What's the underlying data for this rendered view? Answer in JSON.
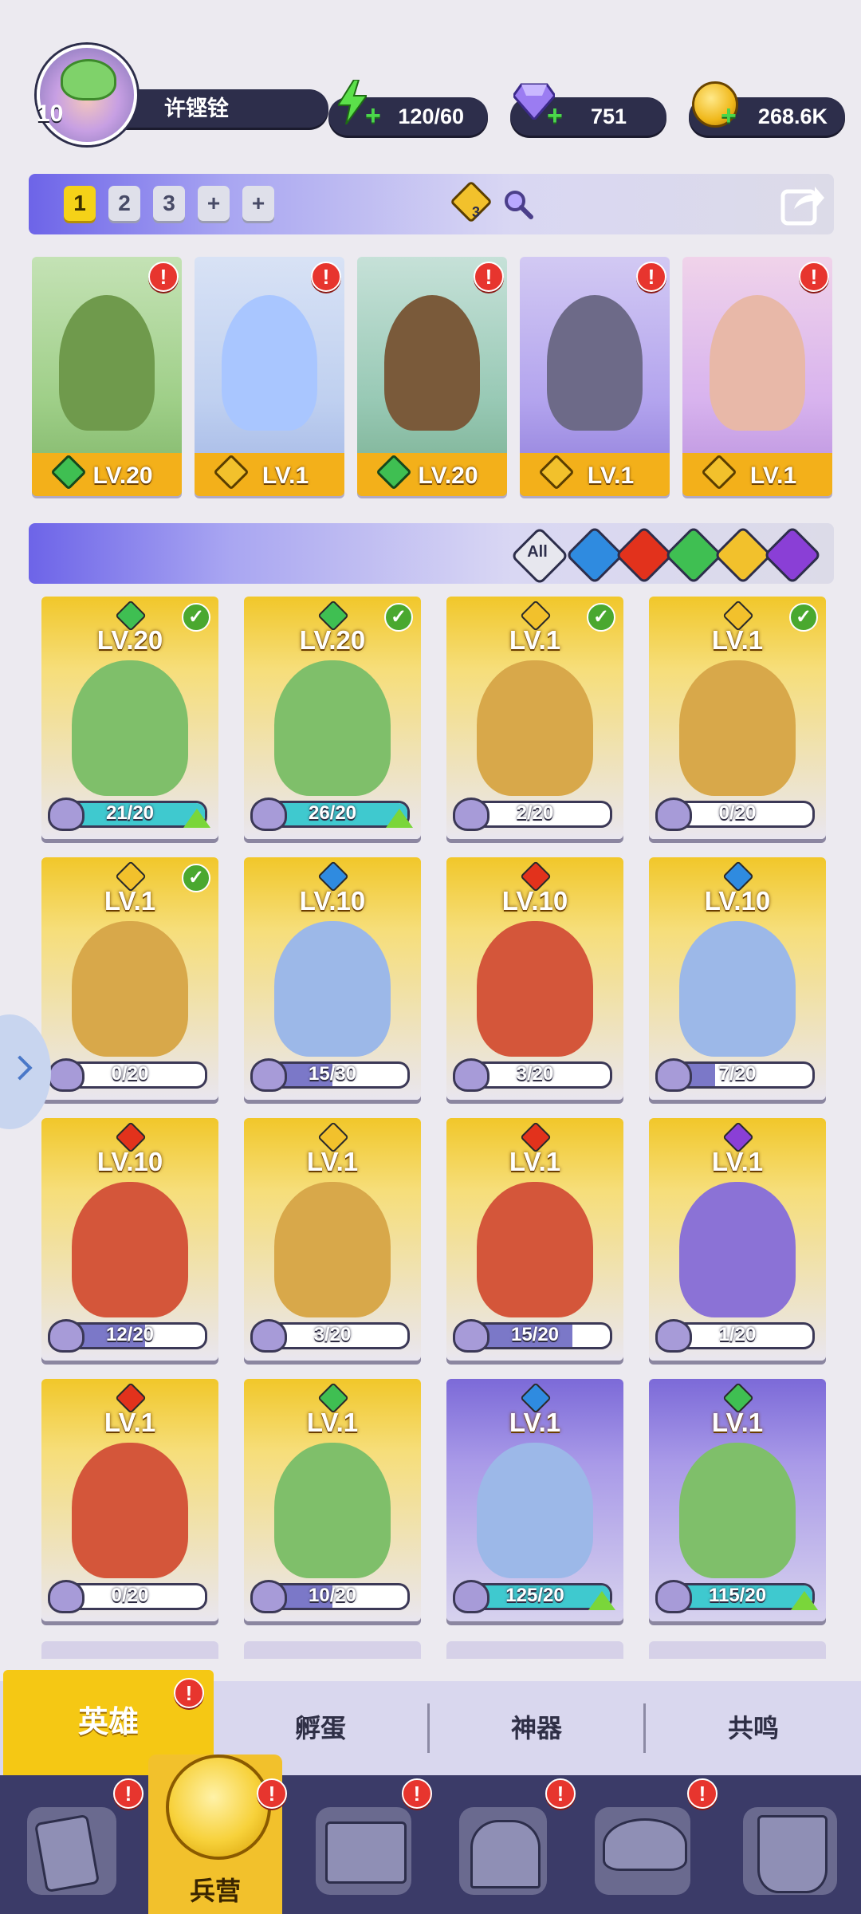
{
  "profile": {
    "level": "10",
    "name": "许铿铨"
  },
  "resources": {
    "energy": "120/60",
    "gems": "751",
    "gold": "268.6K"
  },
  "team_bar": {
    "slots": [
      "1",
      "2",
      "3",
      "+",
      "+"
    ],
    "active_slot": "1",
    "badge_count": "3"
  },
  "team": [
    {
      "level": "LV.20",
      "element": "green",
      "alert": "!"
    },
    {
      "level": "LV.1",
      "element": "gold",
      "alert": "!"
    },
    {
      "level": "LV.20",
      "element": "green",
      "alert": "!"
    },
    {
      "level": "LV.1",
      "element": "gold",
      "alert": "!"
    },
    {
      "level": "LV.1",
      "element": "gold",
      "alert": "!"
    }
  ],
  "filters": {
    "all": "All",
    "elements": [
      "water",
      "fire",
      "wind",
      "light",
      "dark"
    ]
  },
  "heroes": [
    {
      "level": "LV.20",
      "progress": "21/20",
      "element": "green",
      "checked": true,
      "upgrade": true,
      "fill": 1.0
    },
    {
      "level": "LV.20",
      "progress": "26/20",
      "element": "green",
      "checked": true,
      "upgrade": true,
      "fill": 1.0
    },
    {
      "level": "LV.1",
      "progress": "2/20",
      "element": "gold",
      "checked": true,
      "upgrade": false,
      "fill": 0.1
    },
    {
      "level": "LV.1",
      "progress": "0/20",
      "element": "gold",
      "checked": true,
      "upgrade": false,
      "fill": 0.0
    },
    {
      "level": "LV.1",
      "progress": "0/20",
      "element": "gold",
      "checked": true,
      "upgrade": false,
      "fill": 0.0
    },
    {
      "level": "LV.10",
      "progress": "15/30",
      "element": "blue",
      "checked": false,
      "upgrade": false,
      "fill": 0.5
    },
    {
      "level": "LV.10",
      "progress": "3/20",
      "element": "red",
      "checked": false,
      "upgrade": false,
      "fill": 0.15
    },
    {
      "level": "LV.10",
      "progress": "7/20",
      "element": "blue",
      "checked": false,
      "upgrade": false,
      "fill": 0.35
    },
    {
      "level": "LV.10",
      "progress": "12/20",
      "element": "red",
      "checked": false,
      "upgrade": false,
      "fill": 0.6
    },
    {
      "level": "LV.1",
      "progress": "3/20",
      "element": "gold",
      "checked": false,
      "upgrade": false,
      "fill": 0.15
    },
    {
      "level": "LV.1",
      "progress": "15/20",
      "element": "red",
      "checked": false,
      "upgrade": false,
      "fill": 0.75
    },
    {
      "level": "LV.1",
      "progress": "1/20",
      "element": "purple",
      "checked": false,
      "upgrade": false,
      "fill": 0.05
    },
    {
      "level": "LV.1",
      "progress": "0/20",
      "element": "red",
      "checked": false,
      "upgrade": false,
      "fill": 0.0
    },
    {
      "level": "LV.1",
      "progress": "10/20",
      "element": "green",
      "checked": false,
      "upgrade": false,
      "fill": 0.5
    },
    {
      "level": "LV.1",
      "progress": "125/20",
      "element": "blue",
      "checked": false,
      "upgrade": true,
      "fill": 1.0
    },
    {
      "level": "LV.1",
      "progress": "115/20",
      "element": "green",
      "checked": false,
      "upgrade": true,
      "fill": 1.0
    }
  ],
  "tabs": {
    "hero": "英雄",
    "hatch": "孵蛋",
    "artifact": "神器",
    "resonance": "共鸣"
  },
  "nav": {
    "barracks": "兵营",
    "alert": "!"
  },
  "colors": {
    "gold_card": "#f1c72a",
    "purple_card": "#7c6ad8",
    "accent": "#f5d218"
  }
}
